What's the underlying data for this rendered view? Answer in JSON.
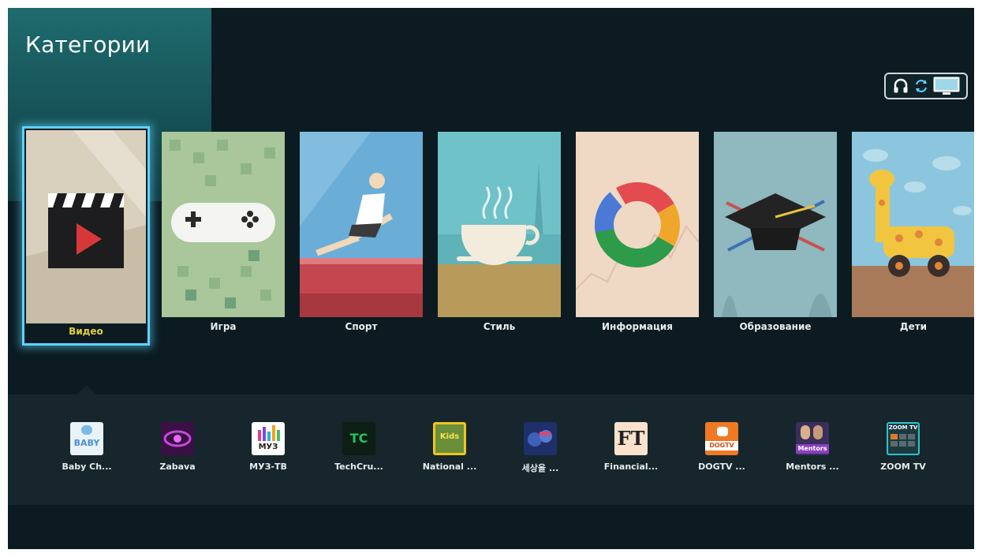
{
  "header": {
    "title": "Категории"
  },
  "categories": [
    {
      "label": "Видео",
      "selected": true
    },
    {
      "label": "Игра"
    },
    {
      "label": "Спорт"
    },
    {
      "label": "Стиль"
    },
    {
      "label": "Информация"
    },
    {
      "label": "Образование"
    },
    {
      "label": "Дети"
    }
  ],
  "apps": [
    {
      "name": "Baby Ch...",
      "tile_text": "BABY"
    },
    {
      "name": "Zabava"
    },
    {
      "name": "МУЗ-ТВ",
      "tile_text": "МУЗ"
    },
    {
      "name": "TechCru...",
      "tile_text": "TC"
    },
    {
      "name": "National ...",
      "tile_text": "Kids"
    },
    {
      "name": "세상을 ..."
    },
    {
      "name": "Financial...",
      "tile_text": "FT"
    },
    {
      "name": "DOGTV ...",
      "tile_text": "DOGTV"
    },
    {
      "name": "Mentors ...",
      "tile_text": "Mentors"
    },
    {
      "name": "ZOOM TV",
      "tile_text": "ZOOM TV"
    }
  ],
  "colors": {
    "background": "#0b1b21",
    "header_panel": "#1e6b6e",
    "focus_border": "#5fd3ff",
    "selected_label": "#e2d03c",
    "apps_bar": "#16262c"
  },
  "icons": {
    "device_indicator": [
      "headphones-icon",
      "sync-icon",
      "tv-icon"
    ]
  }
}
